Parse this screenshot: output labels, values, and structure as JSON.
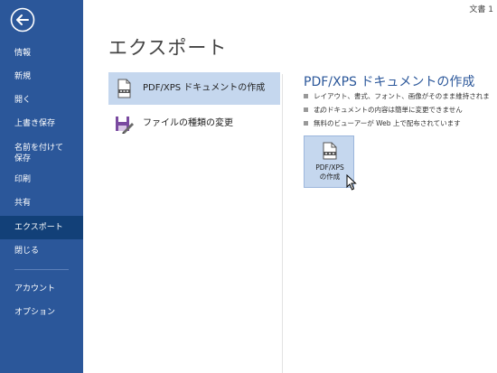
{
  "window": {
    "doc_name": "文書 1"
  },
  "sidebar": {
    "back_icon": "back-arrow-icon",
    "items": [
      {
        "label": "情報"
      },
      {
        "label": "新規"
      },
      {
        "label": "開く"
      },
      {
        "label": "上書き保存"
      },
      {
        "label": "名前を付けて\n保存"
      },
      {
        "label": "印刷"
      },
      {
        "label": "共有"
      },
      {
        "label": "エクスポート"
      },
      {
        "label": "閉じる"
      },
      {
        "label": "アカウント"
      },
      {
        "label": "オプション"
      }
    ],
    "selected": "エクスポート",
    "colors": {
      "background": "#2b579a",
      "selected": "#124078"
    }
  },
  "main": {
    "title": "エクスポート",
    "options": [
      {
        "label": "PDF/XPS ドキュメントの作成",
        "icon": "pdf-document-icon",
        "selected": true
      },
      {
        "label": "ファイルの種類の変更",
        "icon": "change-file-type-icon",
        "selected": false
      }
    ]
  },
  "panel": {
    "title": "PDF/XPS ドキュメントの作成",
    "bullets": [
      "レイアウト、書式、フォント、画像がそのまま維持されます。",
      "このドキュメントの内容は簡単に変更できません",
      "無料のビューアーが Web 上で配布されています"
    ],
    "button_line1": "PDF/XPS",
    "button_line2": "の作成",
    "accent_color": "#2b579a"
  }
}
